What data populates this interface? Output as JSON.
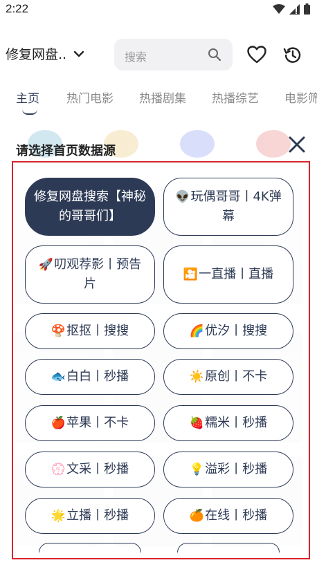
{
  "status_bar": {
    "time": "2:22",
    "icons": [
      "wifi-icon",
      "signal-icon",
      "battery-icon"
    ]
  },
  "header": {
    "source_label": "修复网盘..",
    "search_placeholder": "搜索",
    "icons": [
      "chevron-down-icon",
      "search-icon",
      "heart-icon",
      "history-icon"
    ]
  },
  "tabs": [
    {
      "label": "主页",
      "active": true
    },
    {
      "label": "热门电影",
      "active": false
    },
    {
      "label": "热播剧集",
      "active": false
    },
    {
      "label": "热播综艺",
      "active": false
    },
    {
      "label": "电影筛",
      "active": false
    }
  ],
  "sheet": {
    "title": "请选择首页数据源",
    "sources": [
      {
        "emoji": "",
        "label": "修复网盘搜索【神秘的哥哥们】",
        "selected": true
      },
      {
        "emoji": "👽",
        "label": "玩偶哥哥丨4K弹幕",
        "selected": false
      },
      {
        "emoji": "🚀",
        "label": "叨观荐影丨预告片",
        "selected": false
      },
      {
        "emoji": "🎦",
        "label": "一直播丨直播",
        "selected": false
      },
      {
        "emoji": "🍄",
        "label": "抠抠丨搜搜",
        "selected": false
      },
      {
        "emoji": "🌈",
        "label": "优汐丨搜搜",
        "selected": false
      },
      {
        "emoji": "🐟",
        "label": "白白丨秒播",
        "selected": false
      },
      {
        "emoji": "☀️",
        "label": "原创丨不卡",
        "selected": false
      },
      {
        "emoji": "🍎",
        "label": "苹果丨不卡",
        "selected": false
      },
      {
        "emoji": "🍓",
        "label": "糯米丨秒播",
        "selected": false
      },
      {
        "emoji": "💮",
        "label": "文采丨秒播",
        "selected": false
      },
      {
        "emoji": "💡",
        "label": "溢彩丨秒播",
        "selected": false
      },
      {
        "emoji": "🌟",
        "label": "立播丨秒播",
        "selected": false
      },
      {
        "emoji": "🍊",
        "label": "在线丨秒播",
        "selected": false
      }
    ]
  },
  "colors": {
    "accent": "#2d3a55",
    "highlight_frame": "#d8232a",
    "search_bg": "#f1f1f3"
  }
}
